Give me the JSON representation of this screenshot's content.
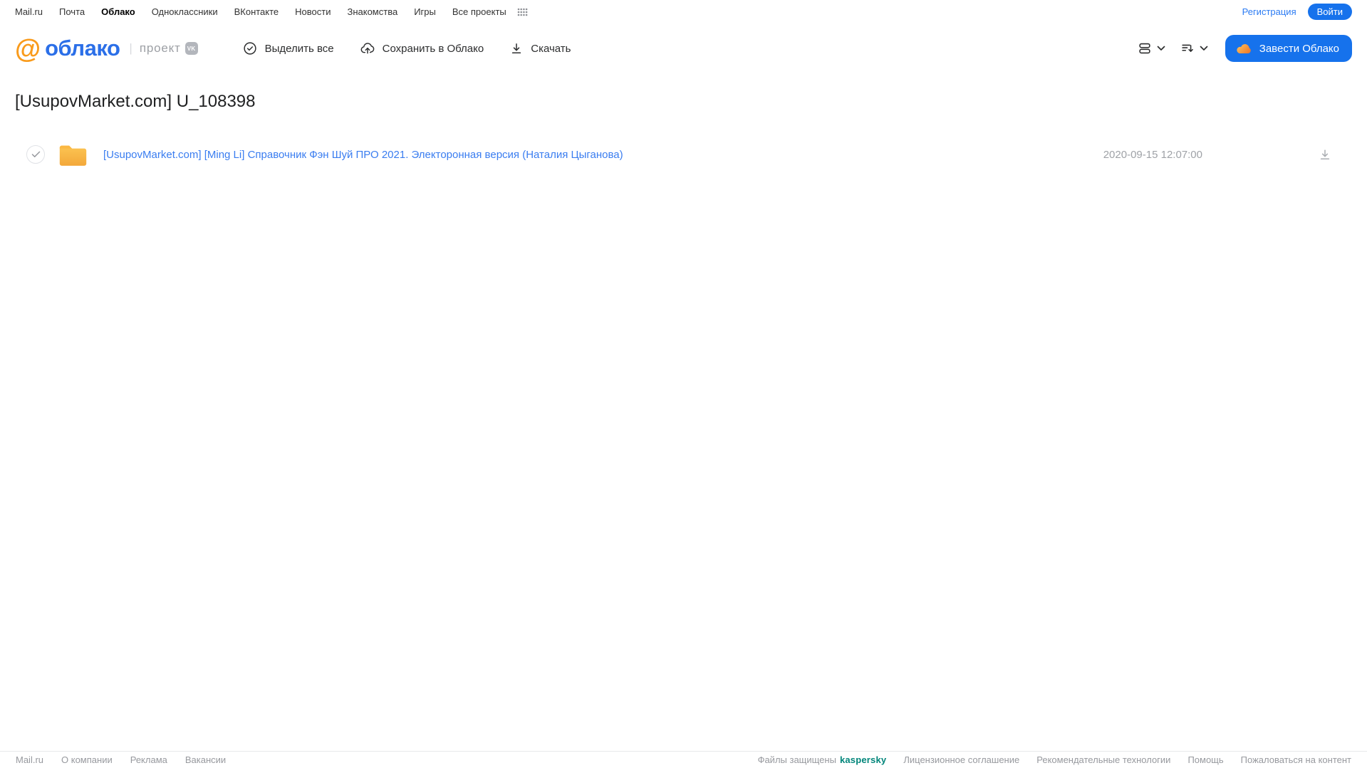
{
  "top_nav": {
    "links": [
      "Mail.ru",
      "Почта",
      "Облако",
      "Одноклассники",
      "ВКонтакте",
      "Новости",
      "Знакомства",
      "Игры",
      "Все проекты"
    ],
    "active_link": "Облако",
    "registration_label": "Регистрация",
    "login_label": "Войти"
  },
  "header": {
    "logo_at": "@",
    "logo_text": "облако",
    "divider": "|",
    "project_label": "проект",
    "vk_badge": "VK",
    "actions": {
      "select_all": "Выделить все",
      "save_to_cloud": "Сохранить в Облако",
      "download": "Скачать"
    },
    "create_cloud_label": "Завести Облако"
  },
  "main": {
    "title": "[UsupovMarket.com] U_108398",
    "files": [
      {
        "type": "folder",
        "name": "[UsupovMarket.com] [Ming Li] Справочник Фэн Шуй ПРО 2021. Электоронная версия (Наталия Цыганова)",
        "date": "2020-09-15 12:07:00"
      }
    ]
  },
  "footer": {
    "left_links": [
      "Mail.ru",
      "О компании",
      "Реклама",
      "Вакансии"
    ],
    "protected_label": "Файлы защищены",
    "protected_brand": "kaspersky",
    "right_links": [
      "Лицензионное соглашение",
      "Рекомендательные технологии",
      "Помощь",
      "Пожаловаться на контент"
    ]
  },
  "colors": {
    "accent_blue": "#1672EC",
    "link_blue": "#2B7BF3",
    "logo_orange": "#F99B1C",
    "logo_blue": "#2B6FE8",
    "folder_yellow": "#F9B642",
    "kaspersky_teal": "#00857A"
  }
}
